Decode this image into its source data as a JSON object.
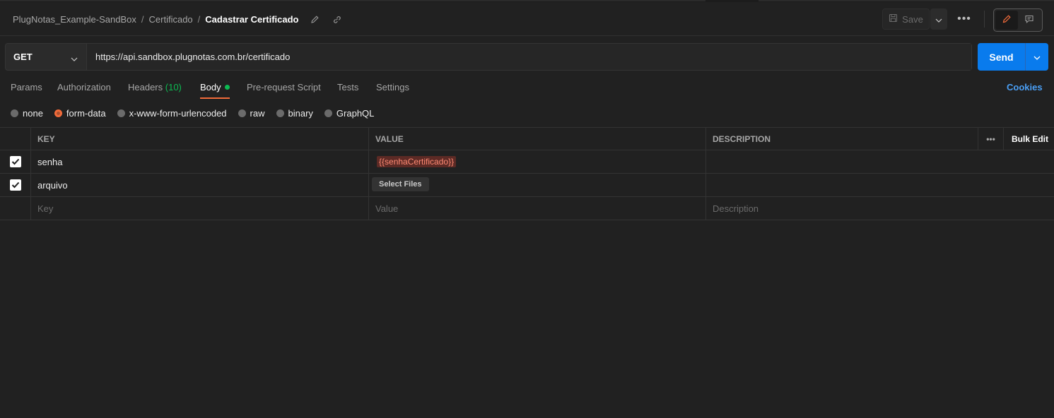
{
  "breadcrumb": {
    "collection": "PlugNotas_Example-SandBox",
    "folder": "Certificado",
    "request": "Cadastrar Certificado",
    "separator": "/"
  },
  "header": {
    "save_label": "Save",
    "more_label": "•••"
  },
  "request": {
    "method": "GET",
    "url": "https://api.sandbox.plugnotas.com.br/certificado",
    "send_label": "Send"
  },
  "tabs": [
    {
      "label": "Params"
    },
    {
      "label": "Authorization"
    },
    {
      "label": "Headers",
      "count": "(10)"
    },
    {
      "label": "Body"
    },
    {
      "label": "Pre-request Script"
    },
    {
      "label": "Tests"
    },
    {
      "label": "Settings"
    }
  ],
  "cookies_label": "Cookies",
  "body_types": [
    {
      "label": "none"
    },
    {
      "label": "form-data"
    },
    {
      "label": "x-www-form-urlencoded"
    },
    {
      "label": "raw"
    },
    {
      "label": "binary"
    },
    {
      "label": "GraphQL"
    }
  ],
  "table": {
    "headers": {
      "key": "KEY",
      "value": "VALUE",
      "description": "DESCRIPTION",
      "more": "•••",
      "bulk_edit": "Bulk Edit"
    },
    "rows": [
      {
        "key": "senha",
        "value": "{{senhaCertificado}}"
      },
      {
        "key": "arquivo",
        "value": "Select Files"
      }
    ],
    "placeholders": {
      "key": "Key",
      "value": "Value",
      "description": "Description"
    }
  },
  "colors": {
    "background": "#212121",
    "accent": "#f26b3a",
    "send": "#097bed",
    "success": "#0cbb52",
    "link": "#4a9ff5"
  }
}
